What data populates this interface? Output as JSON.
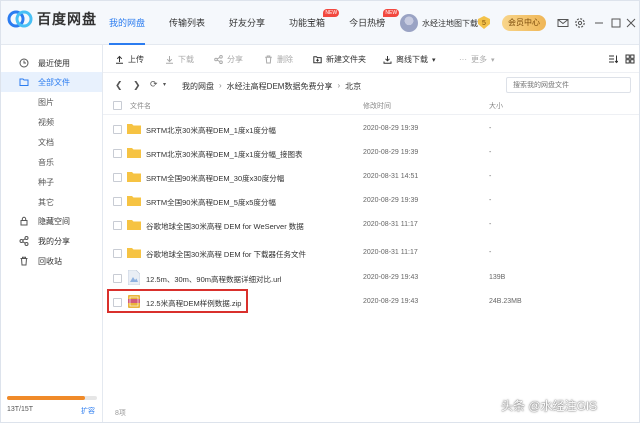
{
  "app": {
    "name": "百度网盘"
  },
  "nav": [
    {
      "label": "我的网盘",
      "active": true,
      "new": false
    },
    {
      "label": "传输列表",
      "active": false,
      "new": false
    },
    {
      "label": "好友分享",
      "active": false,
      "new": false
    },
    {
      "label": "功能宝箱",
      "active": false,
      "new": true
    },
    {
      "label": "今日热榜",
      "active": false,
      "new": true
    }
  ],
  "new_badge": "NEW",
  "user": {
    "name": "水经注地图下载",
    "vip_level": "5",
    "member_label": "会员中心"
  },
  "sidebar": {
    "items": [
      {
        "label": "最近使用",
        "icon": "clock-icon"
      },
      {
        "label": "全部文件",
        "icon": "folder-icon",
        "active": true
      },
      {
        "label": "图片",
        "sub": true
      },
      {
        "label": "视频",
        "sub": true
      },
      {
        "label": "文档",
        "sub": true
      },
      {
        "label": "音乐",
        "sub": true
      },
      {
        "label": "种子",
        "sub": true
      },
      {
        "label": "其它",
        "sub": true
      },
      {
        "label": "隐藏空间",
        "icon": "lock-icon"
      },
      {
        "label": "我的分享",
        "icon": "share-icon"
      },
      {
        "label": "回收站",
        "icon": "trash-icon"
      }
    ],
    "quota_text": "13T/15T",
    "quota_fraction": 0.867,
    "expand_label": "扩容"
  },
  "toolbar": {
    "upload": "上传",
    "download": "下载",
    "share": "分享",
    "delete": "删除",
    "new_folder": "新建文件夹",
    "offline_download": "离线下载",
    "more": "更多"
  },
  "breadcrumb": {
    "root": "我的网盘",
    "path": [
      "水经注高程DEM数据免费分享",
      "北京"
    ]
  },
  "search": {
    "placeholder": "搜索我的网盘文件"
  },
  "columns": {
    "name": "文件名",
    "modified": "修改时间",
    "size": "大小"
  },
  "files": [
    {
      "name": "SRTM北京30米高程DEM_1度x1度分幅",
      "modified": "2020-08-29 19:39",
      "size": "-",
      "type": "folder"
    },
    {
      "name": "SRTM北京30米高程DEM_1度x1度分幅_接图表",
      "modified": "2020-08-29 19:39",
      "size": "-",
      "type": "folder"
    },
    {
      "name": "SRTM全国90米高程DEM_30度x30度分幅",
      "modified": "2020-08-31 14:51",
      "size": "-",
      "type": "folder"
    },
    {
      "name": "SRTM全国90米高程DEM_5度x5度分幅",
      "modified": "2020-08-29 19:39",
      "size": "-",
      "type": "folder"
    },
    {
      "name": "谷歌地球全国30米高程 DEM for WeServer 数据",
      "modified": "2020-08-31 11:17",
      "size": "-",
      "type": "folder"
    },
    {
      "name": "谷歌地球全国30米高程 DEM for 下载器任务文件",
      "modified": "2020-08-31 11:17",
      "size": "-",
      "type": "folder"
    },
    {
      "name": "12.5m、30m、90m高程数据详细对比.url",
      "modified": "2020-08-29 19:43",
      "size": "139B",
      "type": "url"
    },
    {
      "name": "12.5米高程DEM样例数据.zip",
      "modified": "2020-08-29 19:43",
      "size": "24B.23MB",
      "type": "zip"
    }
  ],
  "footer": {
    "count": "8项"
  },
  "watermark": "头条 @水经注GIS",
  "colors": {
    "accent": "#2b7cf0",
    "folder": "#f6c343",
    "highlight": "#d9302c",
    "quota": "#f08a29"
  }
}
